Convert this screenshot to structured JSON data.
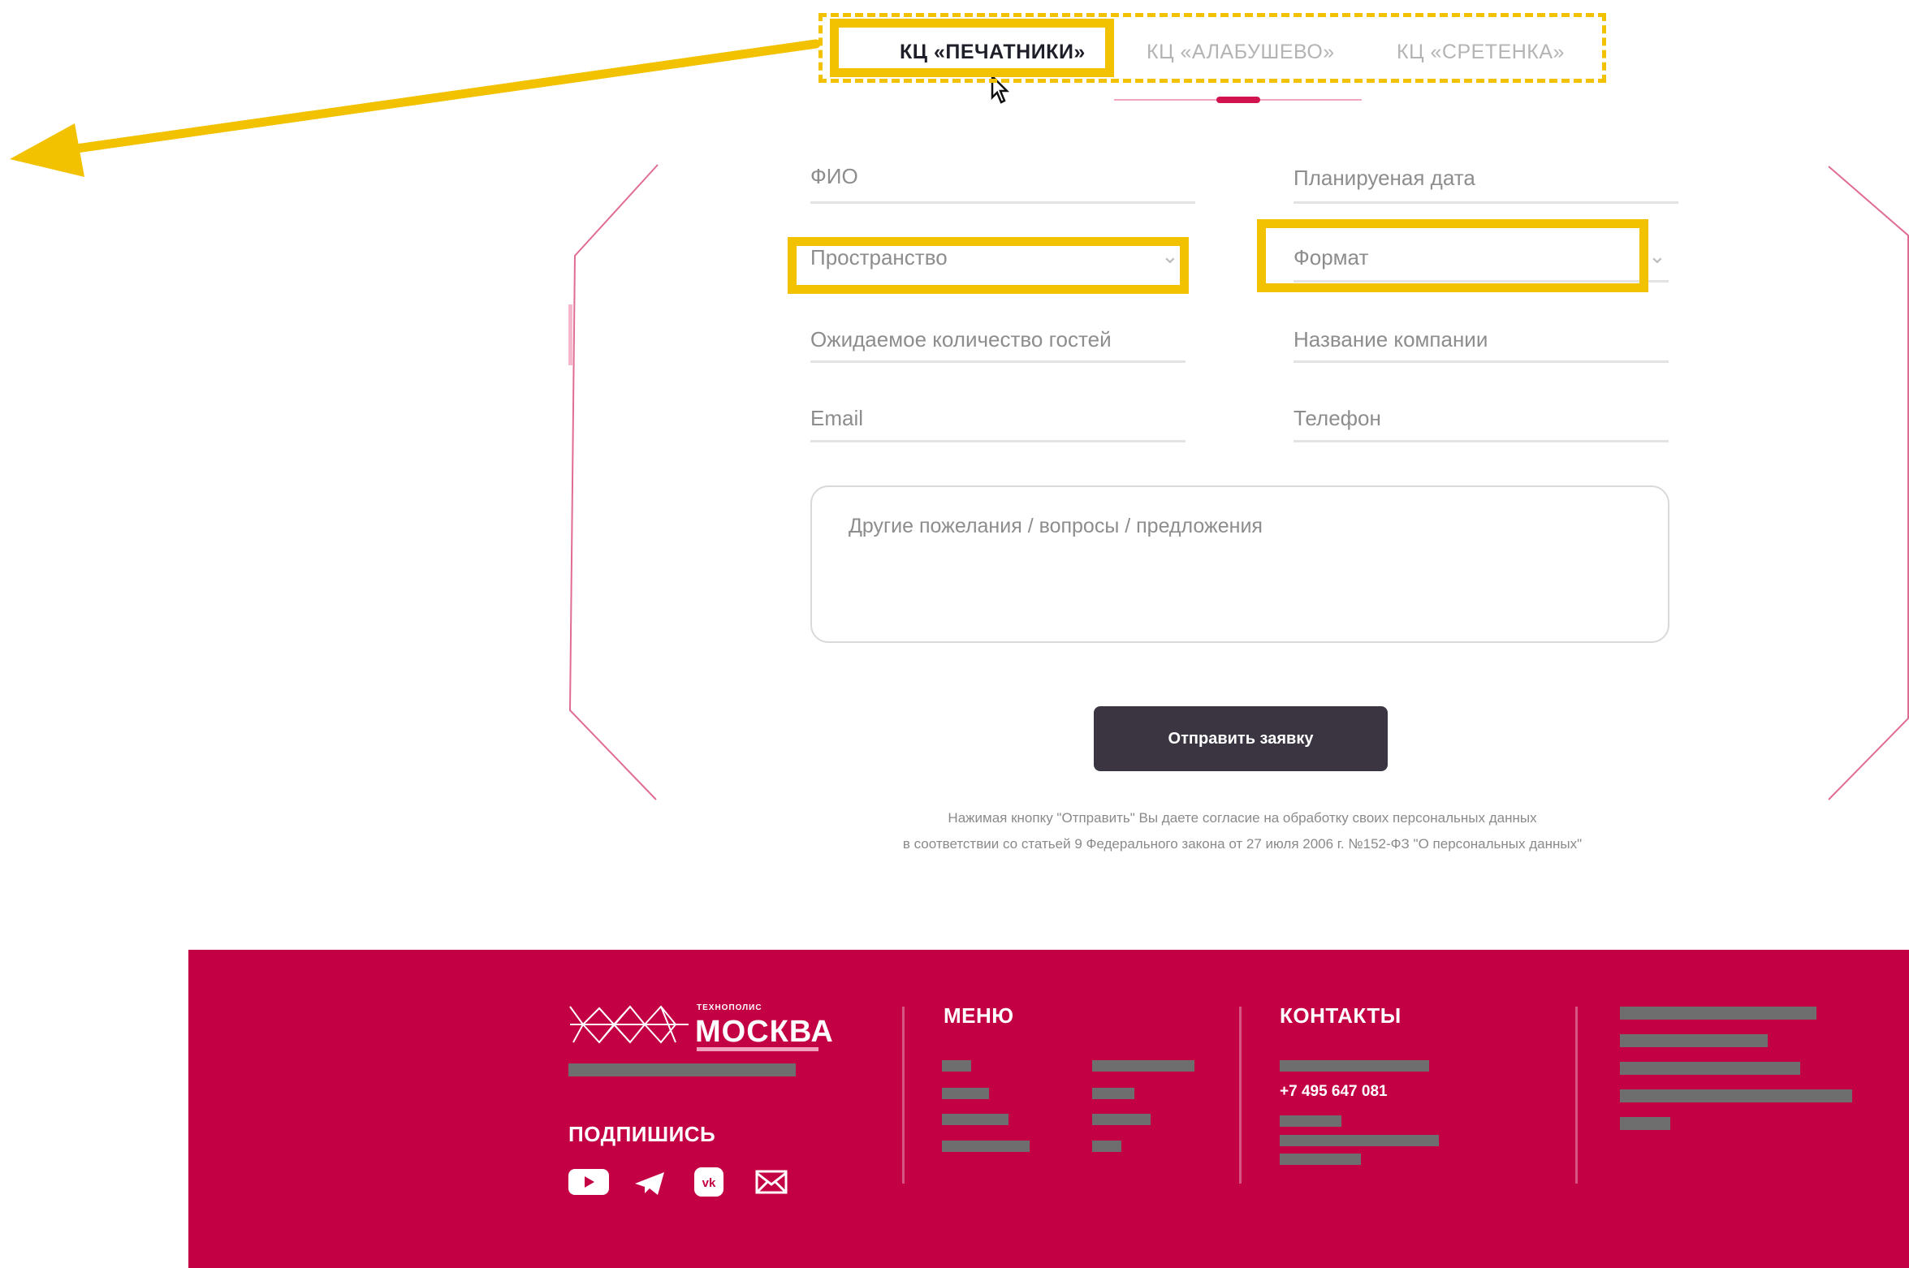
{
  "tabs": [
    {
      "label": "КЦ «ПЕЧАТНИКИ»",
      "active": true
    },
    {
      "label": "КЦ «АЛАБУШЕВО»",
      "active": false
    },
    {
      "label": "КЦ «СРЕТЕНКА»",
      "active": false
    }
  ],
  "form": {
    "fio": "ФИО",
    "planned_date": "Планируеная дата",
    "space": "Пространство",
    "format": "Формат",
    "guests": "Ожидаемое количество гостей",
    "company": "Название компании",
    "email": "Email",
    "phone": "Телефон",
    "comments_placeholder": "Другие пожелания / вопросы / предложения",
    "submit_label": "Отправить заявку",
    "consent_line1": "Нажимая кнопку \"Отправить\" Вы даете согласие на обработку своих персональных данных",
    "consent_line2": "в соответствии со статьей 9 Федерального закона от 27 июля 2006 г. №152-ФЗ \"О персональных данных\""
  },
  "footer": {
    "logo_top": "ТЕХНОПОЛИС",
    "logo_main": "МОСКВА",
    "subscribe_title": "ПОДПИШИСЬ",
    "menu_title": "МЕНЮ",
    "contacts_title": "КОНТАКТЫ",
    "phone": "+7 495 647 081",
    "social_vk": "vk"
  },
  "colors": {
    "accent": "#c40044",
    "annotation": "#f2c200",
    "button": "#3a3541"
  }
}
